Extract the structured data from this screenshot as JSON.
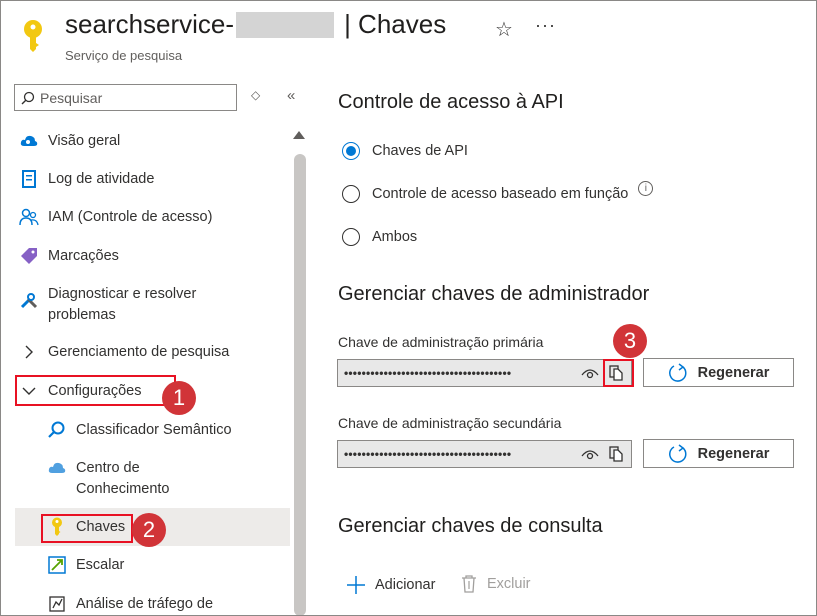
{
  "header": {
    "title_prefix": "searchservice-",
    "title_suffix": "| Chaves",
    "subtitle": "Serviço de pesquisa",
    "favorite_icon": "star-icon",
    "more_icon": "ellipsis-icon"
  },
  "sidebar": {
    "search_placeholder": "Pesquisar",
    "items": [
      {
        "label": "Visão geral",
        "icon": "cloud-search-icon"
      },
      {
        "label": "Log de atividade",
        "icon": "log-icon"
      },
      {
        "label": "IAM (Controle de acesso)",
        "icon": "people-icon"
      },
      {
        "label": "Marcações",
        "icon": "tag-icon"
      },
      {
        "label": "Diagnosticar e resolver",
        "label2": "problemas",
        "icon": "wrench-icon"
      },
      {
        "label": "Gerenciamento de pesquisa",
        "icon": "chevron-right-icon"
      },
      {
        "label": "Configurações",
        "icon": "chevron-down-icon"
      },
      {
        "label": "Classificador Semântico",
        "icon": "search-icon"
      },
      {
        "label": "Centro de",
        "label2": "Conhecimento",
        "icon": "cloud-icon"
      },
      {
        "label": "Chaves",
        "icon": "key-icon"
      },
      {
        "label": "Escalar",
        "icon": "scale-icon"
      },
      {
        "label": "Análise de tráfego de",
        "icon": "chart-icon"
      }
    ],
    "active_item": "Chaves"
  },
  "callouts": [
    "1",
    "2",
    "3"
  ],
  "main": {
    "api_access": {
      "heading": "Controle de acesso à API",
      "options": [
        {
          "label": "Chaves de API",
          "selected": true
        },
        {
          "label": "Controle de acesso baseado em função",
          "selected": false
        },
        {
          "label": "Ambos",
          "selected": false
        }
      ]
    },
    "admin_keys": {
      "heading": "Gerenciar chaves de administrador",
      "primary_label": "Chave de administração primária",
      "primary_value": "••••••••••••••••••••••••••••••••••••••",
      "secondary_label": "Chave de administração secundária",
      "secondary_value": "••••••••••••••••••••••••••••••••••••••",
      "regenerate_label": "Regenerar"
    },
    "query_keys": {
      "heading": "Gerenciar chaves de consulta",
      "add_label": "Adicionar",
      "delete_label": "Excluir"
    }
  },
  "colors": {
    "accent": "#0078d4",
    "callout": "#d13438",
    "highlight_border": "#e81123",
    "key_icon": "#f2c811"
  }
}
